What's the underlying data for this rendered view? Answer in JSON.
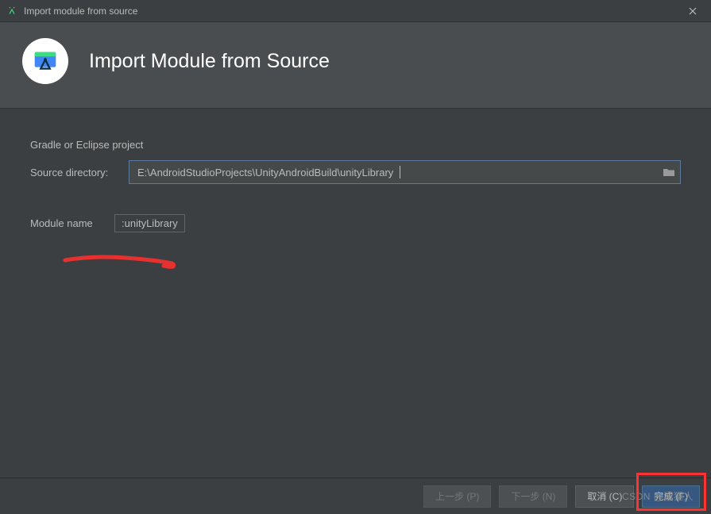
{
  "titlebar": {
    "title": "Import module from source"
  },
  "header": {
    "title": "Import Module from Source"
  },
  "form": {
    "section_label": "Gradle or Eclipse project",
    "source_dir_label": "Source directory:",
    "source_dir_value": "E:\\AndroidStudioProjects\\UnityAndroidBuild\\unityLibrary",
    "module_name_label": "Module name",
    "module_name_value": ":unityLibrary"
  },
  "footer": {
    "prev": "上一步 (P)",
    "next": "下一步 (N)",
    "cancel": "取消 (C)",
    "finish": "完成 (F)"
  },
  "watermark": "CSDN @獾獾人"
}
